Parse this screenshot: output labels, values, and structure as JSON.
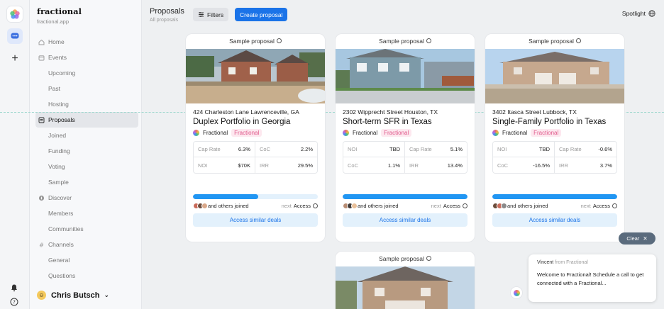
{
  "app": {
    "name": "fractional",
    "domain": "fractional.app"
  },
  "sidebar": {
    "items": [
      {
        "label": "Home",
        "icon": "home-icon",
        "indent": false
      },
      {
        "label": "Events",
        "icon": "calendar-icon",
        "indent": false
      },
      {
        "label": "Upcoming",
        "indent": true
      },
      {
        "label": "Past",
        "indent": true
      },
      {
        "label": "Hosting",
        "indent": true
      },
      {
        "label": "Proposals",
        "icon": "proposal-icon",
        "indent": false,
        "active": true
      },
      {
        "label": "Joined",
        "indent": true
      },
      {
        "label": "Funding",
        "indent": true
      },
      {
        "label": "Voting",
        "indent": true
      },
      {
        "label": "Sample",
        "indent": true
      },
      {
        "label": "Discover",
        "icon": "compass-icon",
        "indent": false
      },
      {
        "label": "Members",
        "indent": true
      },
      {
        "label": "Communities",
        "indent": true
      },
      {
        "label": "Channels",
        "icon": "hash-icon",
        "indent": false
      },
      {
        "label": "General",
        "indent": true
      },
      {
        "label": "Questions",
        "indent": true
      }
    ],
    "user": {
      "name": "Chris Butsch"
    }
  },
  "header": {
    "title": "Proposals",
    "subtitle": "All proposals",
    "filters_label": "Filters",
    "create_label": "Create proposal",
    "spotlight_label": "Spotlight"
  },
  "cards": [
    {
      "header": "Sample proposal",
      "address": "424 Charleston Lane Lawrenceville, GA",
      "title": "Duplex Portfolio in Georgia",
      "owner": "Fractional",
      "badge": "Fractional",
      "metrics": [
        {
          "k": "Cap Rate",
          "v": "6.3%"
        },
        {
          "k": "CoC",
          "v": "2.2%"
        },
        {
          "k": "NOI",
          "v": "$70K"
        },
        {
          "k": "IRR",
          "v": "29.5%"
        }
      ],
      "progress": 0.52,
      "joined_text": "and others joined",
      "next_label": "next",
      "next_value": "Access",
      "similar_label": "Access similar deals"
    },
    {
      "header": "Sample proposal",
      "address": "2302 Wipprecht Street Houston, TX",
      "title": "Short-term SFR in Texas",
      "owner": "Fractional",
      "badge": "Fractional",
      "metrics": [
        {
          "k": "NOI",
          "v": "TBD"
        },
        {
          "k": "Cap Rate",
          "v": "5.1%"
        },
        {
          "k": "CoC",
          "v": "1.1%"
        },
        {
          "k": "IRR",
          "v": "13.4%"
        }
      ],
      "progress": 1.0,
      "joined_text": "and others joined",
      "next_label": "next",
      "next_value": "Access",
      "similar_label": "Access similar deals"
    },
    {
      "header": "Sample proposal",
      "address": "3402 Itasca Street Lubbock, TX",
      "title": "Single-Family Portfolio in Texas",
      "owner": "Fractional",
      "badge": "Fractional",
      "metrics": [
        {
          "k": "NOI",
          "v": "TBD"
        },
        {
          "k": "Cap Rate",
          "v": "-0.6%"
        },
        {
          "k": "CoC",
          "v": "-16.5%"
        },
        {
          "k": "IRR",
          "v": "3.7%"
        }
      ],
      "progress": 1.0,
      "joined_text": "and others joined",
      "next_label": "next",
      "next_value": "Access",
      "similar_label": "Access similar deals"
    },
    {
      "header": "Sample proposal"
    }
  ],
  "clear_label": "Clear",
  "chat": {
    "from_name": "Vincent",
    "from_org": "from Fractional",
    "message": "Welcome to Fractional! Schedule a call to get connected with a Fractional..."
  },
  "colors": {
    "accent": "#1a73e8",
    "progress": "#2196f3",
    "badge_bg": "#fde8ef",
    "badge_text": "#e0598b"
  }
}
